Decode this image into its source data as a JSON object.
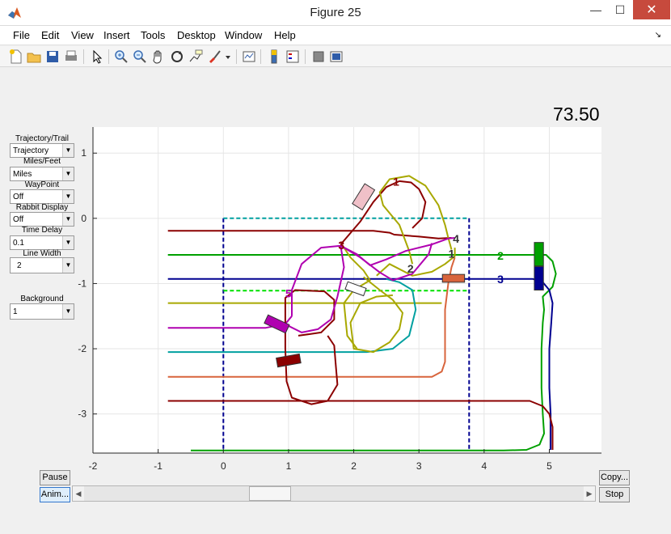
{
  "window": {
    "title": "Figure 25"
  },
  "menu": [
    "File",
    "Edit",
    "View",
    "Insert",
    "Tools",
    "Desktop",
    "Window",
    "Help"
  ],
  "toolbar_icons": [
    "new-figure-icon",
    "open-file-icon",
    "save-icon",
    "print-icon",
    "pointer-icon",
    "zoom-in-icon",
    "zoom-out-icon",
    "pan-icon",
    "rotate-icon",
    "data-cursor-icon",
    "brush-icon",
    "brush-dropdown-icon",
    "link-plot-icon",
    "colorbar-icon",
    "legend-icon",
    "hide-plot-tools-icon",
    "show-plot-tools-icon"
  ],
  "timer": "73.50",
  "controls": {
    "trajectory_label": "Trajectory/Trail",
    "trajectory_value": "Trajectory",
    "units_label": "Miles/Feet",
    "units_value": "Miles",
    "waypoint_label": "WayPoint",
    "waypoint_value": "Off",
    "rabbit_label": "Rabbit Display",
    "rabbit_value": "Off",
    "delay_label": "Time Delay",
    "delay_value": "0.1",
    "linewidth_label": "Line Width",
    "linewidth_value": "2",
    "background_label": "Background",
    "background_value": "1"
  },
  "buttons": {
    "pause": "Pause",
    "anim": "Anim...",
    "copy": "Copy...",
    "stop": "Stop"
  },
  "slider": {
    "value_fraction": 0.36
  },
  "colors": {
    "dark_red": "#8b0000",
    "olive": "#a8a800",
    "magenta": "#b000b0",
    "teal": "#00a0a0",
    "orange": "#d8643c",
    "green": "#00a000",
    "navy": "#000090",
    "grid": "#e6e6e6"
  },
  "chart_data": {
    "type": "line",
    "xlim": [
      -2,
      5.8
    ],
    "ylim": [
      -3.6,
      1.4
    ],
    "xticks": [
      "-2",
      "-1",
      "0",
      "1",
      "2",
      "3",
      "4",
      "5"
    ],
    "yticks": [
      "1",
      "0",
      "-1",
      "-2",
      "-3"
    ],
    "grid": true,
    "labels": [
      {
        "text": "1",
        "x": 2.65,
        "y": 0.56,
        "color": "#8b0000"
      },
      {
        "text": "2",
        "x": 4.25,
        "y": -0.57,
        "color": "#00a000"
      },
      {
        "text": "3",
        "x": 4.25,
        "y": -0.93,
        "color": "#000090"
      },
      {
        "text": "4",
        "x": 3.57,
        "y": -0.31,
        "color": "#333333"
      },
      {
        "text": "1",
        "x": 3.5,
        "y": -0.54,
        "color": "#333333"
      },
      {
        "text": "2",
        "x": 2.87,
        "y": -0.77,
        "color": "#333333"
      },
      {
        "text": "3",
        "x": 1.81,
        "y": -0.41,
        "color": "#8b0000"
      },
      {
        "text": "5",
        "x": 1.0,
        "y": -1.15,
        "color": "#b000b0"
      }
    ],
    "series": [
      {
        "color": "#000090",
        "dashed": true,
        "points": [
          [
            0,
            0
          ],
          [
            0,
            -3.55
          ]
        ]
      },
      {
        "color": "#000090",
        "dashed": true,
        "points": [
          [
            3.77,
            0
          ],
          [
            3.77,
            -3.55
          ]
        ]
      },
      {
        "color": "#00a0a0",
        "dashed": true,
        "points": [
          [
            0,
            0
          ],
          [
            3.77,
            0
          ]
        ]
      },
      {
        "color": "#00e000",
        "dashed": true,
        "points": [
          [
            0,
            -1.11
          ],
          [
            3.77,
            -1.11
          ]
        ]
      },
      {
        "color": "#8b0000",
        "points": [
          [
            -0.85,
            -0.19
          ],
          [
            2.3,
            -0.19
          ],
          [
            2.55,
            -0.22
          ],
          [
            2.62,
            -0.25
          ],
          [
            3.0,
            -0.28
          ],
          [
            3.3,
            -0.31
          ],
          [
            3.5,
            -0.3
          ]
        ]
      },
      {
        "color": "#00a000",
        "points": [
          [
            -0.85,
            -0.56
          ],
          [
            4.8,
            -0.56
          ],
          [
            4.95,
            -0.56
          ],
          [
            5.05,
            -0.66
          ],
          [
            5.1,
            -0.85
          ],
          [
            5.05,
            -1.05
          ],
          [
            4.9,
            -1.2
          ],
          [
            4.92,
            -1.4
          ],
          [
            4.9,
            -1.6
          ],
          [
            4.88,
            -2.0
          ],
          [
            4.88,
            -2.6
          ],
          [
            4.9,
            -3.0
          ],
          [
            4.92,
            -3.3
          ],
          [
            4.85,
            -3.47
          ],
          [
            4.65,
            -3.55
          ],
          [
            4.3,
            -3.56
          ],
          [
            3.0,
            -3.56
          ],
          [
            -0.5,
            -3.56
          ]
        ]
      },
      {
        "color": "#000090",
        "points": [
          [
            -0.85,
            -0.93
          ],
          [
            4.75,
            -0.93
          ],
          [
            4.9,
            -0.98
          ],
          [
            5.0,
            -1.1
          ],
          [
            5.05,
            -1.3
          ],
          [
            5.03,
            -1.6
          ],
          [
            5.0,
            -2.0
          ],
          [
            5.0,
            -2.6
          ],
          [
            5.02,
            -3.0
          ],
          [
            5.02,
            -3.55
          ]
        ]
      },
      {
        "color": "#a8a800",
        "points": [
          [
            -0.85,
            -1.3
          ],
          [
            3.35,
            -1.3
          ]
        ]
      },
      {
        "color": "#b000b0",
        "points": [
          [
            -0.85,
            -1.68
          ],
          [
            0.65,
            -1.68
          ],
          [
            0.95,
            -1.62
          ],
          [
            1.05,
            -1.5
          ]
        ]
      },
      {
        "color": "#00a0a0",
        "points": [
          [
            -0.85,
            -2.05
          ],
          [
            2.2,
            -2.05
          ],
          [
            2.6,
            -2.0
          ],
          [
            2.85,
            -1.8
          ],
          [
            2.95,
            -1.4
          ],
          [
            2.9,
            -1.1
          ],
          [
            2.7,
            -0.98
          ],
          [
            2.5,
            -0.93
          ]
        ]
      },
      {
        "color": "#d8643c",
        "points": [
          [
            -0.85,
            -2.43
          ],
          [
            3.2,
            -2.43
          ],
          [
            3.35,
            -2.35
          ],
          [
            3.4,
            -2.2
          ],
          [
            3.4,
            -1.4
          ],
          [
            3.45,
            -1.0
          ],
          [
            3.5,
            -0.75
          ],
          [
            3.55,
            -0.6
          ]
        ]
      },
      {
        "color": "#8b0000",
        "points": [
          [
            -0.85,
            -2.8
          ],
          [
            4.7,
            -2.8
          ],
          [
            4.9,
            -2.88
          ],
          [
            5.0,
            -3.0
          ],
          [
            5.05,
            -3.2
          ],
          [
            5.05,
            -3.55
          ]
        ]
      },
      {
        "color": "#8b0000",
        "points": [
          [
            1.8,
            -0.4
          ],
          [
            2.1,
            -0.05
          ],
          [
            2.3,
            0.25
          ],
          [
            2.5,
            0.48
          ],
          [
            2.7,
            0.57
          ],
          [
            2.88,
            0.55
          ],
          [
            3.0,
            0.45
          ],
          [
            3.1,
            0.25
          ],
          [
            3.05,
            0.0
          ],
          [
            2.9,
            -0.15
          ]
        ]
      },
      {
        "color": "#8b0000",
        "points": [
          [
            1.15,
            -1.8
          ],
          [
            1.5,
            -1.75
          ],
          [
            1.7,
            -1.55
          ],
          [
            1.7,
            -1.25
          ],
          [
            1.55,
            -1.12
          ],
          [
            1.1,
            -1.1
          ],
          [
            0.95,
            -1.22
          ],
          [
            0.95,
            -1.5
          ],
          [
            0.95,
            -2.0
          ],
          [
            0.97,
            -2.5
          ],
          [
            1.05,
            -2.75
          ],
          [
            1.35,
            -2.85
          ],
          [
            1.6,
            -2.8
          ],
          [
            1.75,
            -2.55
          ],
          [
            1.72,
            -2.2
          ],
          [
            1.7,
            -1.95
          ],
          [
            1.6,
            -1.8
          ]
        ]
      },
      {
        "color": "#a8a800",
        "points": [
          [
            2.15,
            -0.9
          ],
          [
            2.4,
            -1.1
          ],
          [
            2.6,
            -1.25
          ],
          [
            2.75,
            -1.45
          ],
          [
            2.7,
            -1.7
          ],
          [
            2.55,
            -1.9
          ],
          [
            2.3,
            -2.05
          ],
          [
            2.0,
            -2.0
          ],
          [
            1.95,
            -1.6
          ],
          [
            2.1,
            -1.3
          ],
          [
            2.35,
            -1.2
          ],
          [
            2.6,
            -1.18
          ]
        ]
      },
      {
        "color": "#a8a800",
        "points": [
          [
            2.9,
            -0.7
          ],
          [
            2.85,
            -0.5
          ],
          [
            2.7,
            -0.1
          ],
          [
            2.45,
            0.2
          ],
          [
            2.4,
            0.4
          ],
          [
            2.55,
            0.6
          ],
          [
            2.85,
            0.65
          ],
          [
            3.1,
            0.5
          ],
          [
            3.3,
            0.2
          ],
          [
            3.4,
            -0.1
          ],
          [
            3.45,
            -0.3
          ],
          [
            3.5,
            -0.48
          ]
        ]
      },
      {
        "color": "#a8a800",
        "points": [
          [
            1.85,
            -0.45
          ],
          [
            1.95,
            -0.6
          ],
          [
            2.15,
            -0.8
          ],
          [
            2.25,
            -0.95
          ],
          [
            2.0,
            -1.1
          ],
          [
            1.85,
            -1.3
          ],
          [
            1.9,
            -1.8
          ],
          [
            2.05,
            -2.0
          ]
        ]
      },
      {
        "color": "#a8a800",
        "points": [
          [
            2.35,
            -0.88
          ],
          [
            2.55,
            -0.7
          ],
          [
            2.9,
            -0.88
          ],
          [
            3.2,
            -0.82
          ],
          [
            3.4,
            -0.7
          ],
          [
            3.55,
            -0.58
          ],
          [
            3.55,
            -0.45
          ]
        ]
      },
      {
        "color": "#b000b0",
        "points": [
          [
            1.05,
            -1.5
          ],
          [
            1.05,
            -1.1
          ],
          [
            1.2,
            -0.7
          ],
          [
            1.5,
            -0.45
          ],
          [
            1.8,
            -0.42
          ],
          [
            2.05,
            -0.55
          ],
          [
            2.25,
            -0.72
          ],
          [
            2.5,
            -0.63
          ],
          [
            2.8,
            -0.5
          ],
          [
            3.2,
            -0.4
          ],
          [
            3.45,
            -0.31
          ],
          [
            3.55,
            -0.3
          ]
        ]
      },
      {
        "color": "#b000b0",
        "points": [
          [
            1.8,
            -0.42
          ],
          [
            1.85,
            -0.75
          ],
          [
            1.75,
            -1.2
          ],
          [
            1.65,
            -1.55
          ],
          [
            1.45,
            -1.7
          ],
          [
            1.2,
            -1.75
          ],
          [
            1.0,
            -1.65
          ]
        ]
      },
      {
        "color": "#b000b0",
        "points": [
          [
            1.8,
            -0.42
          ],
          [
            2.1,
            -0.6
          ],
          [
            2.4,
            -0.83
          ],
          [
            2.6,
            -0.95
          ],
          [
            2.9,
            -0.85
          ],
          [
            3.15,
            -0.55
          ],
          [
            3.2,
            -0.38
          ]
        ]
      }
    ],
    "vehicles": [
      {
        "x": 2.15,
        "y": 0.33,
        "angle": -58,
        "fill": "#f0c0c8",
        "w": 0.36,
        "h": 0.18
      },
      {
        "x": 0.82,
        "y": -1.62,
        "angle": 25,
        "fill": "#b000b0",
        "w": 0.36,
        "h": 0.14
      },
      {
        "x": 1.0,
        "y": -2.18,
        "angle": -10,
        "fill": "#8b0000",
        "w": 0.36,
        "h": 0.14
      },
      {
        "x": 3.53,
        "y": -0.92,
        "angle": 0,
        "fill": "#d8643c",
        "w": 0.34,
        "h": 0.12
      },
      {
        "x": 4.84,
        "y": -0.55,
        "angle": 90,
        "fill": "#00a000",
        "w": 0.36,
        "h": 0.14
      },
      {
        "x": 4.84,
        "y": -0.92,
        "angle": 90,
        "fill": "#000090",
        "w": 0.36,
        "h": 0.14
      },
      {
        "x": 2.03,
        "y": -1.08,
        "angle": 20,
        "fill": "#ffffff",
        "w": 0.3,
        "h": 0.12
      }
    ]
  }
}
